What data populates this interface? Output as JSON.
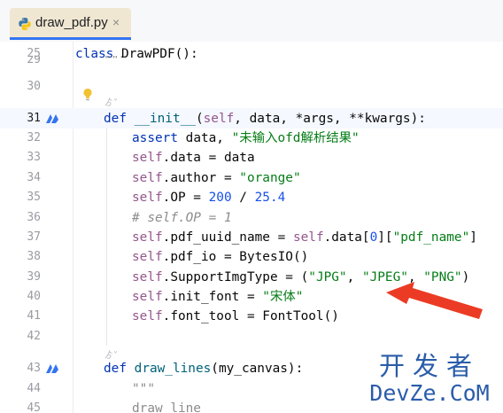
{
  "tab": {
    "filename": "draw_pdf.py",
    "close_glyph": "×",
    "icon": "python-file-icon"
  },
  "editor": {
    "hints": [
      "ゟ˅",
      "ゟ˅"
    ],
    "lines": [
      {
        "num": "25",
        "code": "class DrawPDF():"
      },
      {
        "num": "29",
        "code": "\"\"\""
      },
      {
        "num": "30",
        "code": ""
      },
      {
        "num": "31",
        "code": "def __init__(self, data, *args, **kwargs):"
      },
      {
        "num": "32",
        "code": "assert data, \"未输入ofd解析结果\""
      },
      {
        "num": "33",
        "code": "self.data = data"
      },
      {
        "num": "34",
        "code": "self.author = \"orange\""
      },
      {
        "num": "35",
        "code": "self.OP = 200 / 25.4"
      },
      {
        "num": "36",
        "code": "# self.OP = 1"
      },
      {
        "num": "37",
        "code": "self.pdf_uuid_name = self.data[0][\"pdf_name\"]"
      },
      {
        "num": "38",
        "code": "self.pdf_io = BytesIO()"
      },
      {
        "num": "39",
        "code": "self.SupportImgType = (\"JPG\", \"JPEG\", \"PNG\")"
      },
      {
        "num": "40",
        "code": "self.init_font = \"宋体\""
      },
      {
        "num": "41",
        "code": "self.font_tool = FontTool()"
      },
      {
        "num": "42",
        "code": ""
      },
      {
        "num": "43",
        "code": "def draw_lines(my_canvas):"
      },
      {
        "num": "44",
        "code": "\"\"\""
      },
      {
        "num": "45",
        "code": "draw_line"
      }
    ]
  },
  "watermark": {
    "top": "开发者",
    "bottom": "DevZe.CoM"
  },
  "colors": {
    "keyword": "#0033b3",
    "string": "#067d17",
    "number": "#1750eb",
    "self": "#94558d",
    "function": "#00627a",
    "comment": "#8c8c8c",
    "arrow": "#ec3b24",
    "watermark": "#2a5caa"
  }
}
